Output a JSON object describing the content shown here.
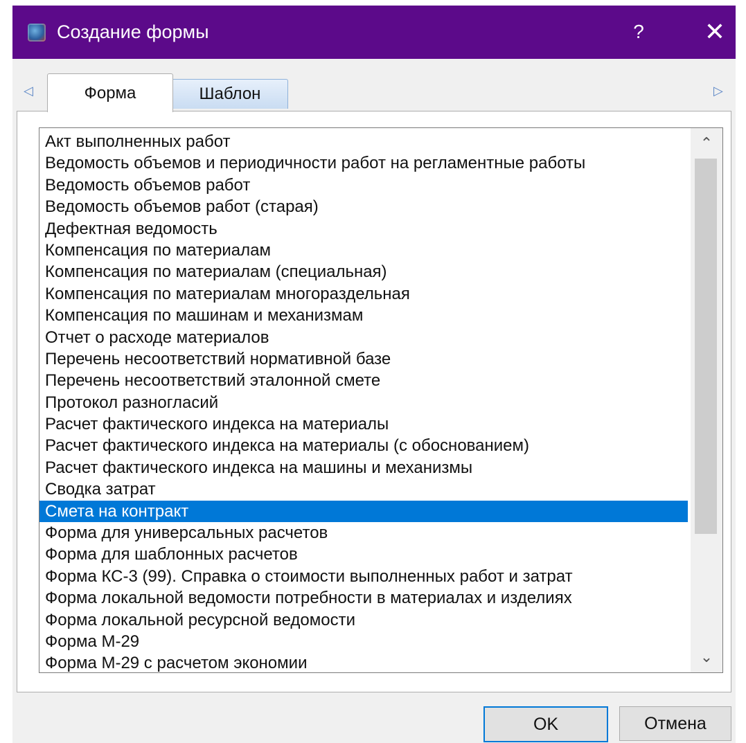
{
  "window": {
    "title": "Создание формы",
    "help_label": "?",
    "close_label": "✕",
    "title_bar_color": "#5c0a8a",
    "app_icon": "app-logo-icon"
  },
  "tabs": {
    "scroll_left": "◁",
    "scroll_right": "▷",
    "items": [
      {
        "label": "Форма",
        "active": true
      },
      {
        "label": "Шаблон",
        "active": false
      }
    ]
  },
  "list": {
    "items": [
      "Акт выполненных работ",
      "Ведомость объемов и периодичности работ на регламентные работы",
      "Ведомость объемов работ",
      "Ведомость объемов работ (старая)",
      "Дефектная ведомость",
      "Компенсация по материалам",
      "Компенсация по материалам (специальная)",
      "Компенсация по материалам многораздельная",
      "Компенсация по машинам и механизмам",
      "Отчет о расходе материалов",
      "Перечень несоответствий нормативной базе",
      "Перечень несоответствий эталонной смете",
      "Протокол разногласий",
      "Расчет фактического индекса на материалы",
      "Расчет фактического индекса на материалы (с обоснованием)",
      "Расчет фактического индекса на машины и механизмы",
      "Сводка затрат",
      "Смета на контракт",
      "Форма для универсальных расчетов",
      "Форма для шаблонных расчетов",
      "Форма КС-3 (99). Справка о стоимости выполненных работ и затрат",
      "Форма локальной ведомости потребности в материалах и изделиях",
      "Форма локальной ресурсной ведомости",
      "Форма М-29",
      "Форма М-29 с расчетом экономии"
    ],
    "selected_index": 17,
    "selection_color": "#0078d7",
    "scroll_up": "⌃",
    "scroll_down": "⌄"
  },
  "buttons": {
    "ok_label": "OK",
    "cancel_label": "Отмена"
  }
}
